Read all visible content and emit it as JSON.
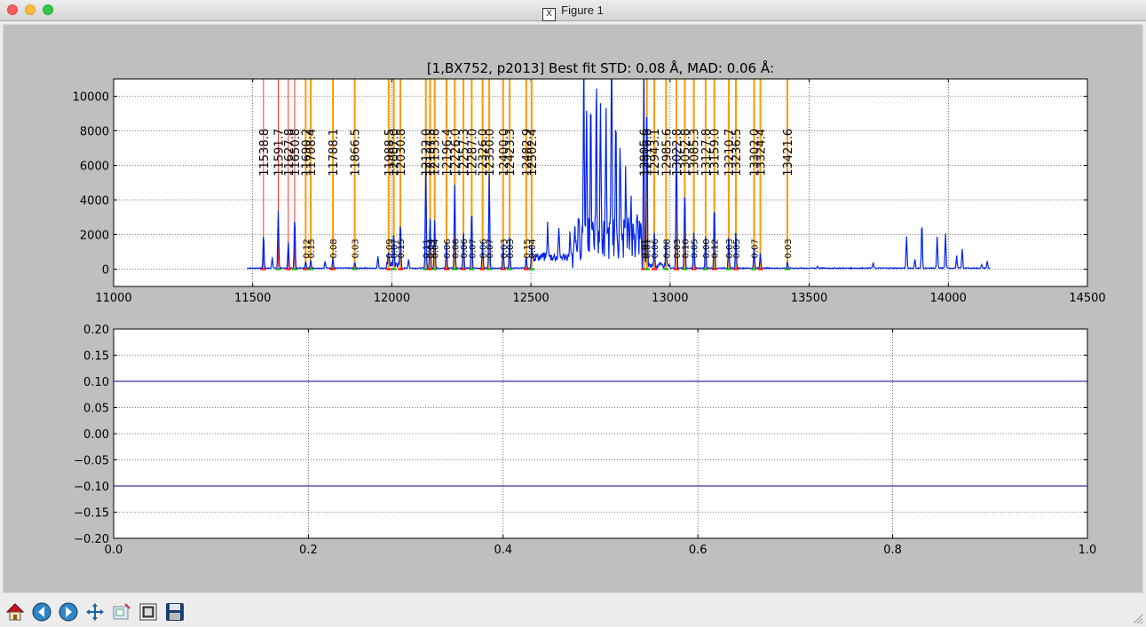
{
  "window": {
    "title": "Figure 1"
  },
  "toolbar": {
    "buttons": [
      {
        "name": "home-button",
        "icon": "home-icon"
      },
      {
        "name": "back-button",
        "icon": "arrow-left-icon"
      },
      {
        "name": "forward-button",
        "icon": "arrow-right-icon"
      },
      {
        "name": "pan-button",
        "icon": "move-icon"
      },
      {
        "name": "zoom-button",
        "icon": "zoom-rect-icon"
      },
      {
        "name": "subplots-button",
        "icon": "subplots-icon"
      },
      {
        "name": "save-button",
        "icon": "save-icon"
      }
    ]
  },
  "colors": {
    "spectrum": "#0022ee",
    "line_fit": "#ff9900",
    "red_marker": "#ff0000",
    "green_marker": "#00aa00",
    "residual_band": "#000088"
  },
  "chart_data": [
    {
      "type": "line",
      "title": "[1,BX752, p2013] Best fit STD: 0.08 Å, MAD: 0.06 Å:",
      "xlim": [
        11000,
        14500
      ],
      "ylim": [
        -1000,
        11000
      ],
      "x_ticks": [
        "11000",
        "11500",
        "12000",
        "12500",
        "13000",
        "13500",
        "14000",
        "14500"
      ],
      "y_ticks": [
        "0",
        "2000",
        "4000",
        "6000",
        "8000",
        "10000"
      ],
      "grid": true,
      "line_labels": [
        "11538.8",
        "11591.7",
        "11627.8",
        "11650.8",
        "11690.2",
        "11708.4",
        "11788.1",
        "11866.5",
        "11988.5",
        "12007.0",
        "12030.8",
        "12122.0",
        "12137.5",
        "12153.8",
        "12196.4",
        "12226.0",
        "12257.3",
        "12287.0",
        "12326.0",
        "12350.0",
        "12400.0",
        "12423.3",
        "12482.9",
        "12502.4",
        "12905.6",
        "12916.6",
        "12943.1",
        "12985.6",
        "13022.8",
        "13052.8",
        "13085.3",
        "13127.8",
        "13159.0",
        "13210.7",
        "13236.5",
        "13302.0",
        "13324.4",
        "13421.6"
      ],
      "lines": [
        {
          "x": 11538.8,
          "label": "11538.8",
          "offset": null,
          "kind": "red",
          "peak": 2000
        },
        {
          "x": 11591.7,
          "label": "11591.7",
          "offset": null,
          "kind": "red",
          "peak": 3400
        },
        {
          "x": 11627.8,
          "label": "11627.8",
          "offset": null,
          "kind": "red",
          "peak": 1500
        },
        {
          "x": 11650.8,
          "label": "11650.8",
          "offset": null,
          "kind": "red",
          "peak": 3000
        },
        {
          "x": 11690.2,
          "label": "11690.2",
          "offset": "0.12",
          "kind": "orange",
          "peak": 400
        },
        {
          "x": 11708.4,
          "label": "11708.4",
          "offset": "0.15",
          "kind": "orange",
          "peak": 500
        },
        {
          "x": 11788.1,
          "label": "11788.1",
          "offset": "0.08",
          "kind": "orange",
          "peak": 600
        },
        {
          "x": 11866.5,
          "label": "11866.5",
          "offset": "0.03",
          "kind": "orange",
          "peak": 350
        },
        {
          "x": 11988.5,
          "label": "11988.5",
          "offset": "0.09",
          "kind": "orange",
          "peak": 900
        },
        {
          "x": 12007.0,
          "label": "12007.0",
          "offset": "0.07",
          "kind": "orange",
          "peak": 1800
        },
        {
          "x": 12030.8,
          "label": "12030.8",
          "offset": "0.15",
          "kind": "orange",
          "peak": 2700
        },
        {
          "x": 12122.0,
          "label": "12122.0",
          "offset": "0.11",
          "kind": "orange",
          "peak": 6200
        },
        {
          "x": 12137.5,
          "label": "12137.5",
          "offset": "0.04",
          "kind": "orange",
          "peak": 3000
        },
        {
          "x": 12153.8,
          "label": "12153.8",
          "offset": "0.04",
          "kind": "orange",
          "peak": 2800
        },
        {
          "x": 12196.4,
          "label": "12196.4",
          "offset": "0.06",
          "kind": "orange",
          "peak": 1500
        },
        {
          "x": 12226.0,
          "label": "12226.0",
          "offset": "0.06",
          "kind": "orange",
          "peak": 4800
        },
        {
          "x": 12257.3,
          "label": "12257.3",
          "offset": "0.06",
          "kind": "orange",
          "peak": 2200
        },
        {
          "x": 12287.0,
          "label": "12287.0",
          "offset": "0.07",
          "kind": "orange",
          "peak": 3500
        },
        {
          "x": 12326.0,
          "label": "12326.0",
          "offset": "0.06",
          "kind": "orange",
          "peak": 1500
        },
        {
          "x": 12350.0,
          "label": "12350.0",
          "offset": "0.07",
          "kind": "orange",
          "peak": 5500
        },
        {
          "x": 12400.0,
          "label": "12400.0",
          "offset": "0.03",
          "kind": "orange",
          "peak": 1400
        },
        {
          "x": 12423.3,
          "label": "12423.3",
          "offset": "0.03",
          "kind": "orange",
          "peak": 1900
        },
        {
          "x": 12482.9,
          "label": "12482.9",
          "offset": "0.15",
          "kind": "orange",
          "peak": 700
        },
        {
          "x": 12502.4,
          "label": "12502.4",
          "offset": "0.04",
          "kind": "orange",
          "peak": 900
        },
        {
          "x": 12905.6,
          "label": "12905.6",
          "offset": "0.01",
          "kind": "orange",
          "peak": 11000
        },
        {
          "x": 12916.6,
          "label": "12916.6",
          "offset": "0.01",
          "kind": "orange",
          "peak": 9000
        },
        {
          "x": 12943.1,
          "label": "12943.1",
          "offset": "0.06",
          "kind": "orange",
          "peak": 2000
        },
        {
          "x": 12985.6,
          "label": "12985.6",
          "offset": "0.08",
          "kind": "orange",
          "peak": 1500
        },
        {
          "x": 13022.8,
          "label": "13022.8",
          "offset": "0.03",
          "kind": "orange",
          "peak": 8000
        },
        {
          "x": 13052.8,
          "label": "13052.8",
          "offset": "0.10",
          "kind": "orange",
          "peak": 4600
        },
        {
          "x": 13085.3,
          "label": "13085.3",
          "offset": "0.05",
          "kind": "orange",
          "peak": 2200
        },
        {
          "x": 13127.8,
          "label": "13127.8",
          "offset": "0.00",
          "kind": "orange",
          "peak": 1800
        },
        {
          "x": 13159.0,
          "label": "13159.0",
          "offset": "0.12",
          "kind": "orange",
          "peak": 3800
        },
        {
          "x": 13210.7,
          "label": "13210.7",
          "offset": "0.03",
          "kind": "orange",
          "peak": 1900
        },
        {
          "x": 13236.5,
          "label": "13236.5",
          "offset": "0.05",
          "kind": "orange",
          "peak": 2100
        },
        {
          "x": 13302.0,
          "label": "13302.0",
          "offset": "0.07",
          "kind": "orange",
          "peak": 1200
        },
        {
          "x": 13324.4,
          "label": "13324.4",
          "offset": null,
          "kind": "orange",
          "peak": 900
        },
        {
          "x": 13421.6,
          "label": "13421.6",
          "offset": "0.03",
          "kind": "orange",
          "peak": 350
        }
      ],
      "extra_peaks": [
        {
          "x": 11570,
          "y": 600
        },
        {
          "x": 11760,
          "y": 400
        },
        {
          "x": 11950,
          "y": 700
        },
        {
          "x": 12060,
          "y": 500
        },
        {
          "x": 12560,
          "y": 1900
        },
        {
          "x": 12600,
          "y": 1800
        },
        {
          "x": 12640,
          "y": 1400
        },
        {
          "x": 12690,
          "y": 11000
        },
        {
          "x": 12700,
          "y": 8000
        },
        {
          "x": 12715,
          "y": 7000
        },
        {
          "x": 12735,
          "y": 9000
        },
        {
          "x": 12750,
          "y": 7500
        },
        {
          "x": 12770,
          "y": 6800
        },
        {
          "x": 12790,
          "y": 11000
        },
        {
          "x": 12805,
          "y": 6000
        },
        {
          "x": 12820,
          "y": 5500
        },
        {
          "x": 12840,
          "y": 3500
        },
        {
          "x": 12860,
          "y": 2500
        },
        {
          "x": 12880,
          "y": 1800
        },
        {
          "x": 13530,
          "y": 100
        },
        {
          "x": 13730,
          "y": 300
        },
        {
          "x": 13850,
          "y": 1850
        },
        {
          "x": 13880,
          "y": 500
        },
        {
          "x": 13905,
          "y": 2700
        },
        {
          "x": 13960,
          "y": 1800
        },
        {
          "x": 13990,
          "y": 2000
        },
        {
          "x": 14030,
          "y": 700
        },
        {
          "x": 14050,
          "y": 1100
        },
        {
          "x": 14120,
          "y": 200
        },
        {
          "x": 14140,
          "y": 400
        }
      ],
      "x_range": [
        11480,
        14150
      ]
    },
    {
      "type": "line",
      "title": "",
      "xlim": [
        0.0,
        1.0
      ],
      "ylim": [
        -0.2,
        0.2
      ],
      "x_ticks": [
        "0.0",
        "0.2",
        "0.4",
        "0.6",
        "0.8",
        "1.0"
      ],
      "y_ticks": [
        "−0.20",
        "−0.15",
        "−0.10",
        "−0.05",
        "0.00",
        "0.05",
        "0.10",
        "0.15",
        "0.20"
      ],
      "grid": true,
      "series": [
        {
          "values": [
            0.1,
            0.1
          ]
        },
        {
          "values": [
            -0.1,
            -0.1
          ]
        }
      ]
    }
  ]
}
